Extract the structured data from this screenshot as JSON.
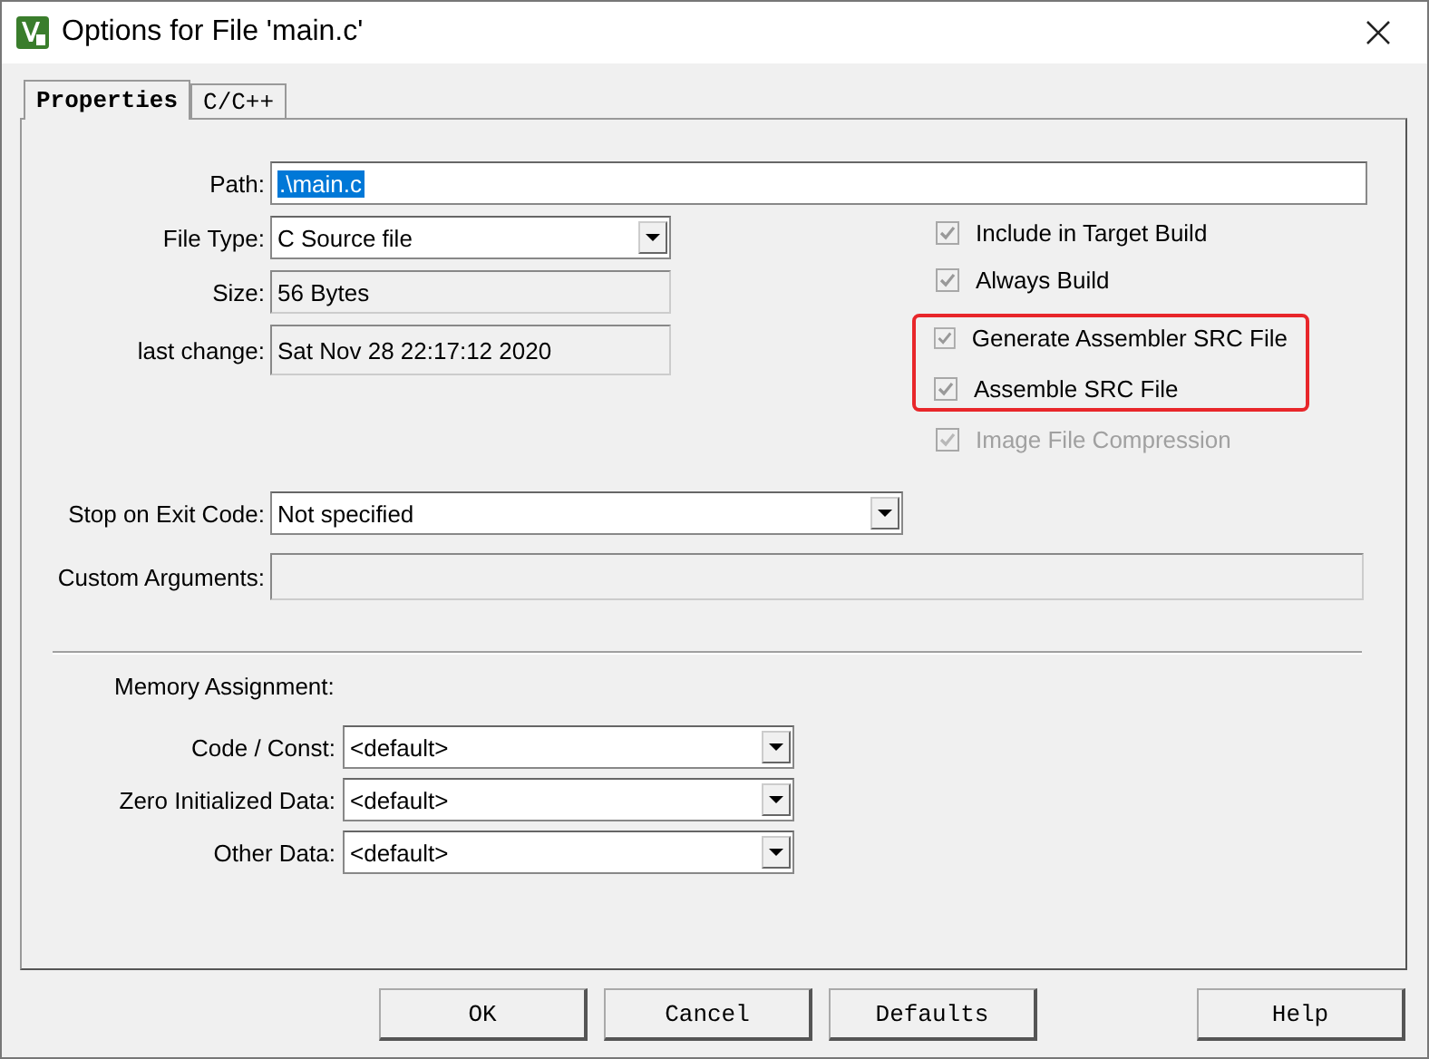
{
  "window": {
    "title": "Options for File 'main.c'"
  },
  "tabs": [
    {
      "label": "Properties",
      "selected": true
    },
    {
      "label": "C/C++",
      "selected": false
    }
  ],
  "path": {
    "label": "Path:",
    "value": ".\\main.c"
  },
  "file_type": {
    "label": "File Type:",
    "value": "C Source file"
  },
  "size": {
    "label": "Size:",
    "value": "56 Bytes"
  },
  "last_change": {
    "label": "last change:",
    "value": "Sat Nov 28 22:17:12 2020"
  },
  "stop_on_exit": {
    "label": "Stop on Exit Code:",
    "value": "Not specified"
  },
  "custom_arguments": {
    "label": "Custom Arguments:"
  },
  "checkboxes": [
    {
      "label": "Include in Target Build",
      "checked": true,
      "disabled": false,
      "highlighted": false
    },
    {
      "label": "Always Build",
      "checked": true,
      "disabled": false,
      "highlighted": false
    },
    {
      "label": "Generate Assembler SRC File",
      "checked": true,
      "disabled": false,
      "highlighted": true
    },
    {
      "label": "Assemble SRC File",
      "checked": true,
      "disabled": false,
      "highlighted": true
    },
    {
      "label": "Image File Compression",
      "checked": true,
      "disabled": true,
      "highlighted": false
    }
  ],
  "memory": {
    "title": "Memory Assignment:",
    "rows": [
      {
        "label": "Code / Const:",
        "value": "<default>"
      },
      {
        "label": "Zero Initialized Data:",
        "value": "<default>"
      },
      {
        "label": "Other Data:",
        "value": "<default>"
      }
    ]
  },
  "buttons": [
    "OK",
    "Cancel",
    "Defaults",
    "Help"
  ]
}
